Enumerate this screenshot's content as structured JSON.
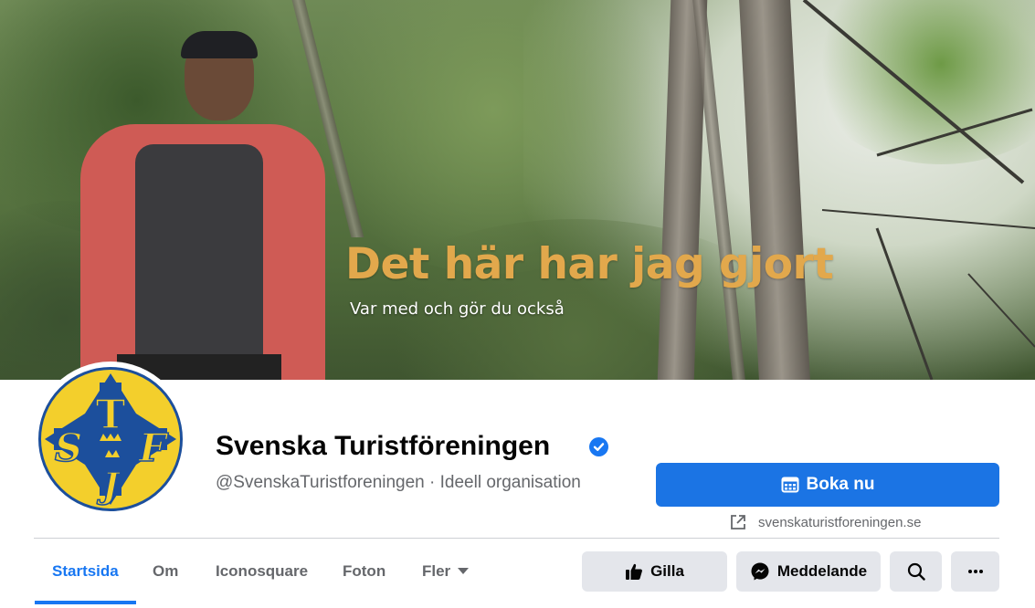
{
  "cover": {
    "headline": "Det här har jag gjort",
    "subline": "Var med och gör du också"
  },
  "profile": {
    "name": "Svenska Turistföreningen",
    "verified": true,
    "handle_line": "@SvenskaTuristforeningen · Ideell organisation",
    "logo_letters": "STF"
  },
  "cta": {
    "book_label": "Boka nu",
    "website": "svenskaturistforeningen.se"
  },
  "tabs": [
    {
      "label": "Startsida",
      "active": true
    },
    {
      "label": "Om",
      "active": false
    },
    {
      "label": "Iconosquare",
      "active": false
    },
    {
      "label": "Foton",
      "active": false
    },
    {
      "label": "Fler",
      "active": false
    }
  ],
  "actions": {
    "like_label": "Gilla",
    "message_label": "Meddelande"
  },
  "icons": [
    "verified-badge-icon",
    "calendar-icon",
    "external-link-icon",
    "caret-down-icon",
    "thumbs-up-icon",
    "messenger-icon",
    "search-icon",
    "more-icon"
  ],
  "colors": {
    "accent": "#1877f2",
    "button_primary": "#1b74e4",
    "button_secondary": "#e4e6eb",
    "headline": "#e2a84c",
    "logo_yellow": "#f3cf2c",
    "logo_blue": "#1c4f9c"
  }
}
